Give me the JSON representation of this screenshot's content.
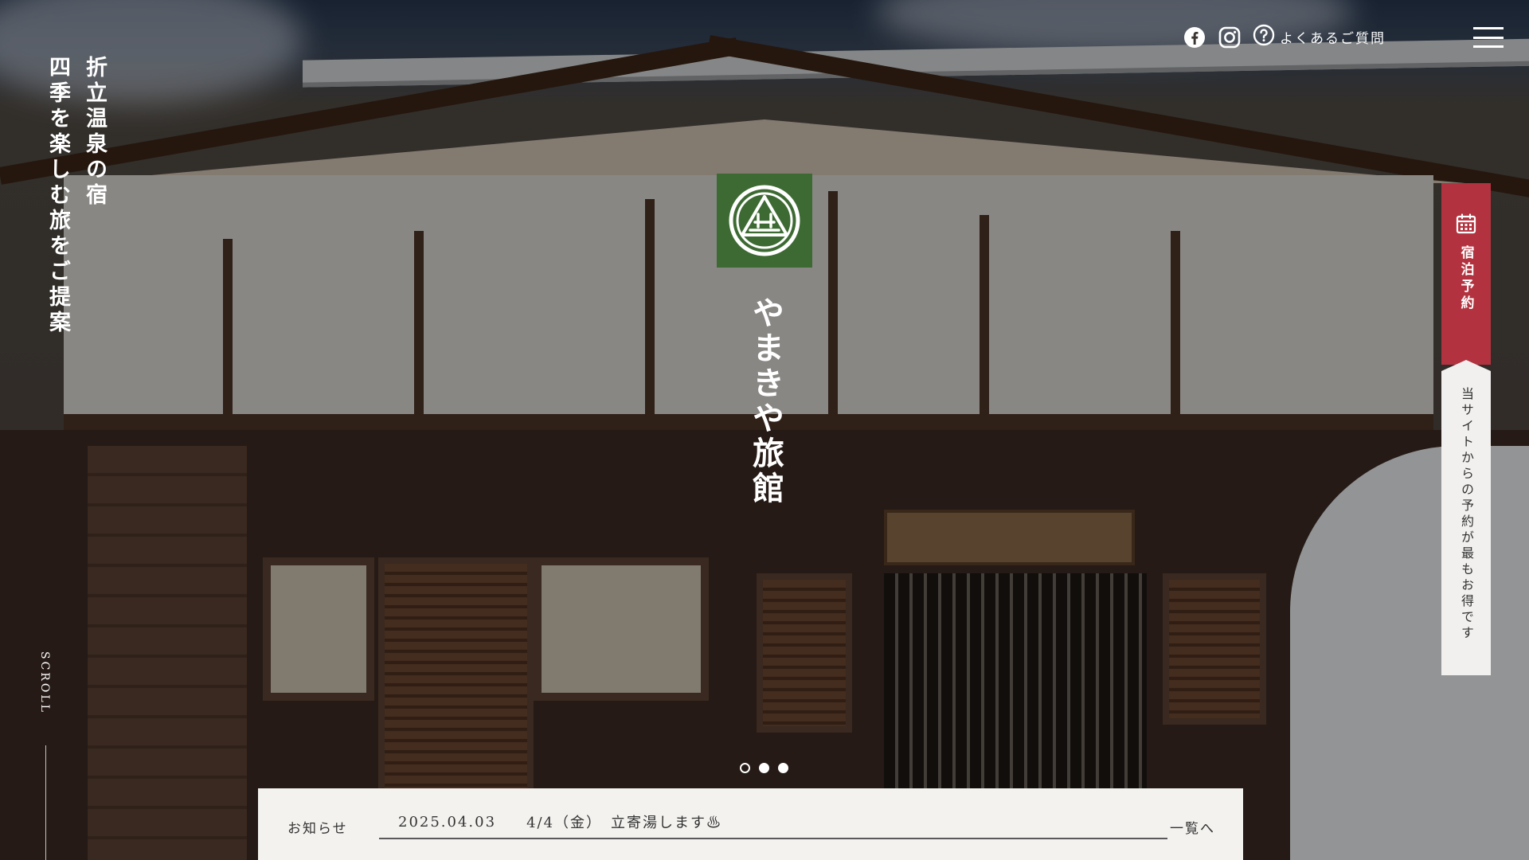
{
  "catchcopy": {
    "line1": "折立温泉の宿",
    "line2": "四季を楽しむ旅をご提案"
  },
  "header": {
    "facebook_icon": "facebook-icon",
    "instagram_icon": "instagram-icon",
    "faq_icon": "question-circle-icon",
    "faq_label": "よくあるご質問",
    "menu_icon": "hamburger-menu-icon"
  },
  "brand": {
    "logo_icon": "yamakiya-crest-icon",
    "logo_bg": "#3d6a33",
    "name": "やまきや旅館"
  },
  "booking": {
    "icon": "calendar-icon",
    "label": "宿泊予約",
    "accent": "#b2333f",
    "note": "当サイトからの予約が最もお得です"
  },
  "scroll_label": "SCROLL",
  "slider": {
    "count": 3,
    "active_indices": [
      1,
      2
    ]
  },
  "news": {
    "title": "お知らせ",
    "date": "2025.04.03",
    "headline": "4/4（金）　立寄湯します♨",
    "more_label": "一覧へ"
  }
}
